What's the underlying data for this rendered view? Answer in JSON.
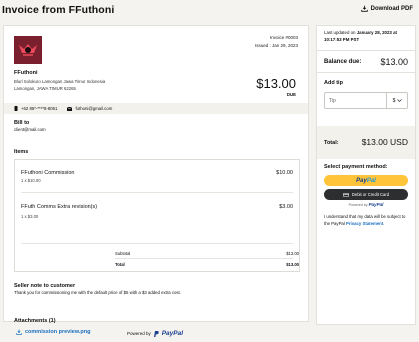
{
  "header": {
    "title": "Invoice from FFuthoni",
    "download_label": "Download PDF"
  },
  "invoice": {
    "number_line": "Invoice #0003",
    "issued_line": "Issued : Jan 29, 2023",
    "seller_name": "FFuthoni",
    "seller_address": "Blurl Solokuro Lamongan Jawa Timur Indonesia Lamongan, JAWA TIMUR 62265",
    "amount": "$13.00",
    "amount_label": "DUE",
    "phone": "+62 85*-****8-8061",
    "email": "futhoni@gmail.com",
    "bill_to_heading": "Bill to",
    "bill_to_email": "client@mail.com",
    "items_heading": "Items",
    "items": [
      {
        "name": "FFuthoni Commission",
        "qty_price": "1 x $10.00",
        "price": "$10.00"
      },
      {
        "name": "FFuth Comms Extra revision(s)",
        "qty_price": "1 x $3.00",
        "price": "$3.00"
      }
    ],
    "subtotal_label": "Subtotal",
    "subtotal": "$13.00",
    "total_label": "Total",
    "total": "$13.00",
    "note_heading": "Seller note to customer",
    "note": "Thank you for commissioning me with the default price of $5 with a $3 added extra cost.",
    "attachments_heading": "Attachments (1)",
    "attachment_file": "commission preview.png"
  },
  "footer": {
    "powered_by": "Powered by",
    "brand": "PayPal"
  },
  "sidebar": {
    "updated_prefix": "Last updated on ",
    "updated_value": "January 28, 2023 at 10:17:53 PM PST",
    "balance_label": "Balance due:",
    "balance_value": "$13.00",
    "tip_label": "Add tip",
    "tip_placeholder": "Tip",
    "tip_currency": "$",
    "total_label": "Total:",
    "total_value": "$13.00 USD",
    "payment_heading": "Select payment method:",
    "paypal_button_a": "Pay",
    "paypal_button_b": "Pal",
    "card_button": "Debit or Credit Card",
    "powered_small": "Powered by",
    "powered_brand": "PayPal",
    "consent_text": "I understand that my data will be subject to the PayPal ",
    "consent_link": "Privacy Statement",
    "consent_end": "."
  },
  "colors": {
    "accent_link": "#1a6fc0",
    "paypal_yellow": "#ffc439",
    "paypal_navy": "#143e8c",
    "band": "#f3f1ec",
    "logo_bg": "#7a1f2e"
  },
  "icons": [
    "download-icon",
    "phone-icon",
    "mail-icon",
    "paperclip-icon",
    "chevron-down-icon",
    "card-icon",
    "seller-logo"
  ]
}
